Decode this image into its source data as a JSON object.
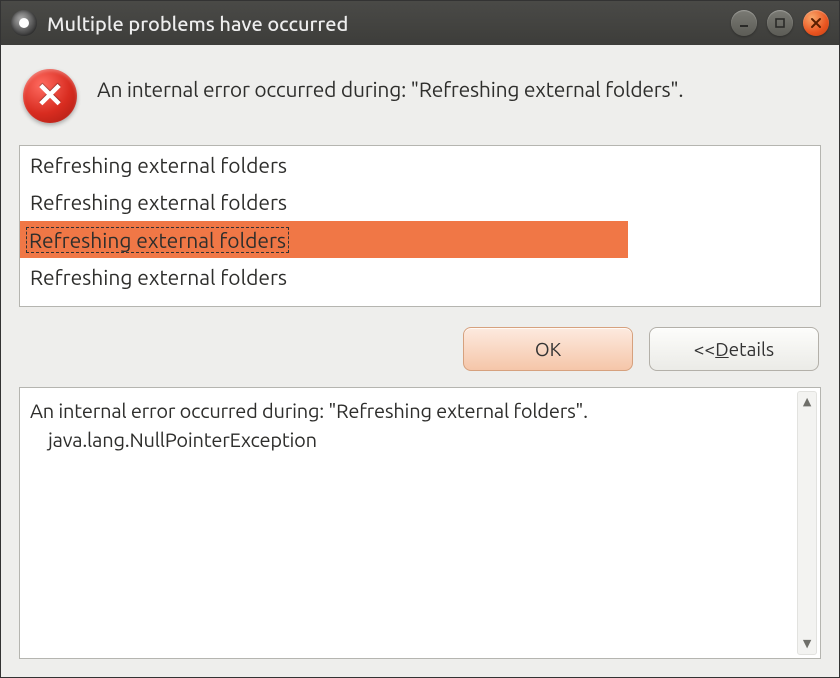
{
  "window": {
    "title": "Multiple problems have occurred"
  },
  "message": "An internal error occurred during: \"Refreshing external folders\".",
  "problems": [
    {
      "label": "Refreshing external folders",
      "selected": false
    },
    {
      "label": "Refreshing external folders",
      "selected": false
    },
    {
      "label": "Refreshing external folders",
      "selected": true
    },
    {
      "label": "Refreshing external folders",
      "selected": false
    }
  ],
  "buttons": {
    "ok": "OK",
    "details_prefix": "<< ",
    "details_letter": "D",
    "details_rest": "etails"
  },
  "details": {
    "line1": "An internal error occurred during: \"Refreshing external folders\".",
    "line2": "java.lang.NullPointerException"
  }
}
